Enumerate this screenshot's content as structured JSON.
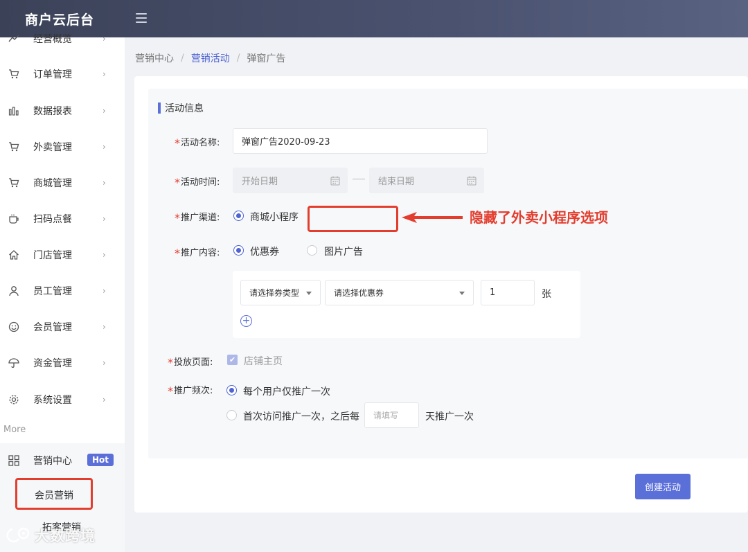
{
  "header": {
    "title": "商户云后台"
  },
  "sidebar": {
    "items": [
      {
        "label": "经营概览",
        "icon": "trend-icon"
      },
      {
        "label": "订单管理",
        "icon": "cart-icon"
      },
      {
        "label": "数据报表",
        "icon": "bar-chart-icon"
      },
      {
        "label": "外卖管理",
        "icon": "cart-icon"
      },
      {
        "label": "商城管理",
        "icon": "cart-icon"
      },
      {
        "label": "扫码点餐",
        "icon": "cup-icon"
      },
      {
        "label": "门店管理",
        "icon": "home-icon"
      },
      {
        "label": "员工管理",
        "icon": "user-icon"
      },
      {
        "label": "会员管理",
        "icon": "smile-icon"
      },
      {
        "label": "资金管理",
        "icon": "umbrella-icon"
      },
      {
        "label": "系统设置",
        "icon": "gear-icon"
      }
    ],
    "arrow": "›",
    "more_label": "More",
    "marketing": {
      "label": "营销中心",
      "badge": "Hot"
    },
    "sub_items": [
      "会员营销",
      "拓客营销"
    ]
  },
  "breadcrumb": [
    "营销中心",
    "营销活动",
    "弹窗广告"
  ],
  "breadcrumb_sep": "/",
  "form": {
    "section_title": "活动信息",
    "star": "*",
    "name_label": "活动名称:",
    "name_value": "弹窗广告2020-09-23",
    "time_label": "活动时间:",
    "start_placeholder": "开始日期",
    "end_placeholder": "结束日期",
    "channel_label": "推广渠道:",
    "channel_option": "商城小程序",
    "content_label": "推广内容:",
    "content_options": [
      "优惠券",
      "图片广告"
    ],
    "coupon_type_placeholder": "请选择券类型",
    "coupon_placeholder": "请选择优惠券",
    "coupon_qty": "1",
    "coupon_unit": "张",
    "page_label": "投放页面:",
    "page_option": "店铺主页",
    "freq_label": "推广频次:",
    "freq_option_1": "每个用户仅推广一次",
    "freq_option_2_prefix": "首次访问推广一次，之后每",
    "freq_days_placeholder": "请填写",
    "freq_option_2_suffix": "天推广一次",
    "submit": "创建活动"
  },
  "annotation": "隐藏了外卖小程序选项",
  "watermark": "大数跨境",
  "colors": {
    "accent": "#5b6fd8",
    "annotation_red": "#e33d2e",
    "header": "#3b4258"
  }
}
